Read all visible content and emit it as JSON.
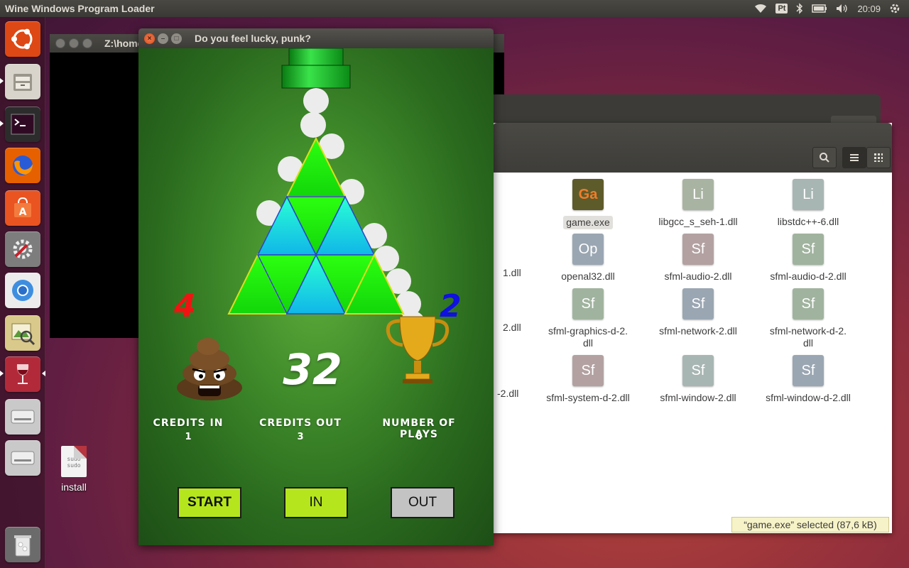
{
  "topbar": {
    "app_title": "Wine Windows Program Loader",
    "keyboard_layout": "Pt",
    "clock": "20:09"
  },
  "desktop": {
    "install_icon_text": "sudo\nsudo",
    "install_label": "install"
  },
  "terminal": {
    "title": "Z:\\home"
  },
  "file_manager": {
    "files": [
      {
        "icon_text": "Ga",
        "name": "game.exe",
        "selected": true,
        "color": "#5e5b2b"
      },
      {
        "icon_text": "Li",
        "name": "libgcc_s_seh-1.dll",
        "color": "#a9b3a2"
      },
      {
        "icon_text": "Li",
        "name": "libstdc++-6.dll",
        "color": "#a8b6b3"
      },
      {
        "icon_text": "Op",
        "name": "openal32.dll",
        "color": "#9aa6b2"
      },
      {
        "icon_text": "Sf",
        "name": "sfml-audio-2.dll",
        "color": "#b3a1a1"
      },
      {
        "icon_text": "Sf",
        "name": "sfml-audio-d-2.dll",
        "color": "#a0b39e"
      },
      {
        "icon_text": "Sf",
        "name": "sfml-graphics-d-2.\ndll",
        "color": "#a0b39e"
      },
      {
        "icon_text": "Sf",
        "name": "sfml-network-2.dll",
        "color": "#9aa6b2"
      },
      {
        "icon_text": "Sf",
        "name": "sfml-network-d-2.\ndll",
        "color": "#a0b39e"
      },
      {
        "icon_text": "Sf",
        "name": "sfml-system-d-2.dll",
        "color": "#b3a1a1"
      },
      {
        "icon_text": "Sf",
        "name": "sfml-window-2.dll",
        "color": "#a8b6b3"
      },
      {
        "icon_text": "Sf",
        "name": "sfml-window-d-2.dll",
        "color": "#9aa6b2"
      }
    ],
    "partial_names": [
      "1.dll",
      "2.dll",
      "-2.dll"
    ],
    "status": "“game.exe” selected  (87,6 kB)"
  },
  "game": {
    "window_title": "Do you feel lucky, punk?",
    "credits_in_value": "4",
    "credits_out_value": "2",
    "center_number": "32",
    "labels": {
      "credits_in": "CREDITS IN",
      "credits_out": "CREDITS OUT",
      "plays": "NUMBER OF PLAYS"
    },
    "values": {
      "credits_in": "1",
      "credits_out": "3",
      "plays": "0"
    },
    "buttons": {
      "start": "START",
      "in": "IN",
      "out": "OUT"
    },
    "colors": {
      "red": "#f31212",
      "blue": "#1010e0",
      "button_green": "#b5e61d",
      "button_grey": "#c3c3c3"
    }
  }
}
